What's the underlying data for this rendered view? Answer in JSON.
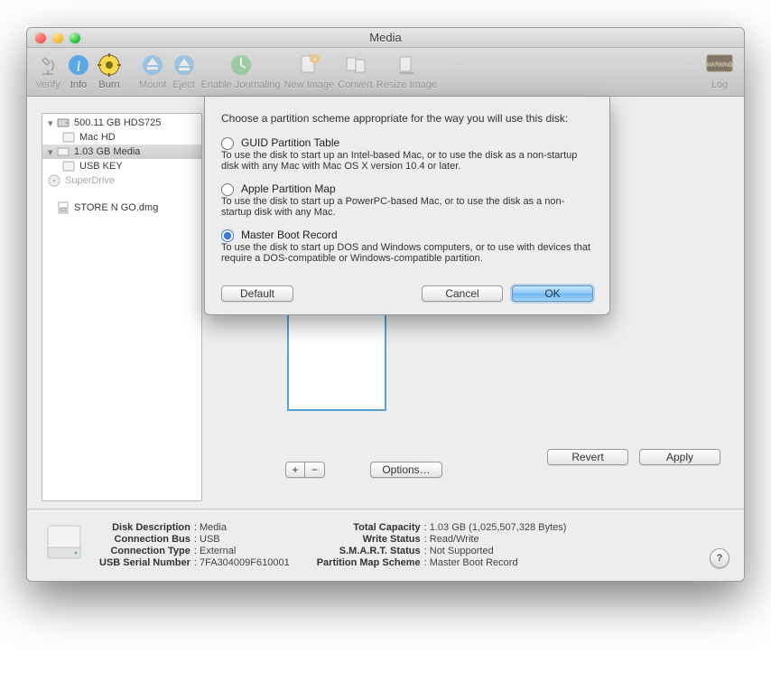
{
  "window": {
    "title": "Media"
  },
  "toolbar": {
    "items": [
      {
        "label": "Verify",
        "icon": "microscope-icon"
      },
      {
        "label": "Info",
        "icon": "info-icon"
      },
      {
        "label": "Burn",
        "icon": "burn-icon"
      },
      {
        "label": "Mount",
        "icon": "mount-icon"
      },
      {
        "label": "Eject",
        "icon": "eject-icon"
      },
      {
        "label": "Enable Journaling",
        "icon": "journal-icon"
      },
      {
        "label": "New Image",
        "icon": "new-image-icon"
      },
      {
        "label": "Convert",
        "icon": "convert-icon"
      },
      {
        "label": "Resize Image",
        "icon": "resize-icon"
      }
    ],
    "log_label": "Log"
  },
  "sidebar": {
    "items": [
      {
        "label": "500.11 GB HDS725",
        "icon": "hdd-icon",
        "expandable": true
      },
      {
        "label": "Mac HD",
        "icon": "volume-icon",
        "indent": 1
      },
      {
        "label": "1.03 GB Media",
        "icon": "hdd-icon",
        "expandable": true,
        "selected": true
      },
      {
        "label": "USB KEY",
        "icon": "volume-icon",
        "indent": 1
      },
      {
        "label": "SuperDrive",
        "icon": "optical-icon",
        "disabled": true
      }
    ],
    "dmg": {
      "label": "STORE N GO.dmg",
      "icon": "dmg-icon"
    }
  },
  "partition": {
    "add_label": "+",
    "remove_label": "−",
    "options_label": "Options…",
    "revert_label": "Revert",
    "apply_label": "Apply"
  },
  "sheet": {
    "prompt": "Choose a partition scheme appropriate for the way you will use this disk:",
    "options": [
      {
        "label": "GUID Partition Table",
        "desc": "To use the disk to start up an Intel-based Mac, or to use the disk as a non-startup disk with any Mac with Mac OS X version 10.4 or later.",
        "selected": false
      },
      {
        "label": "Apple Partition Map",
        "desc": "To use the disk to start up a PowerPC-based Mac, or to use the disk as a non-startup disk with any Mac.",
        "selected": false
      },
      {
        "label": "Master Boot Record",
        "desc": "To use the disk to start up DOS and Windows computers, or to use with devices that require a DOS-compatible or Windows-compatible partition.",
        "selected": true
      }
    ],
    "default_label": "Default",
    "cancel_label": "Cancel",
    "ok_label": "OK"
  },
  "footer": {
    "left": [
      {
        "k": "Disk Description",
        "v": "Media"
      },
      {
        "k": "Connection Bus",
        "v": "USB"
      },
      {
        "k": "Connection Type",
        "v": "External"
      },
      {
        "k": "USB Serial Number",
        "v": "7FA304009F610001"
      }
    ],
    "right": [
      {
        "k": "Total Capacity",
        "v": "1.03 GB (1,025,507,328 Bytes)"
      },
      {
        "k": "Write Status",
        "v": "Read/Write"
      },
      {
        "k": "S.M.A.R.T. Status",
        "v": "Not Supported"
      },
      {
        "k": "Partition Map Scheme",
        "v": "Master Boot Record"
      }
    ]
  }
}
